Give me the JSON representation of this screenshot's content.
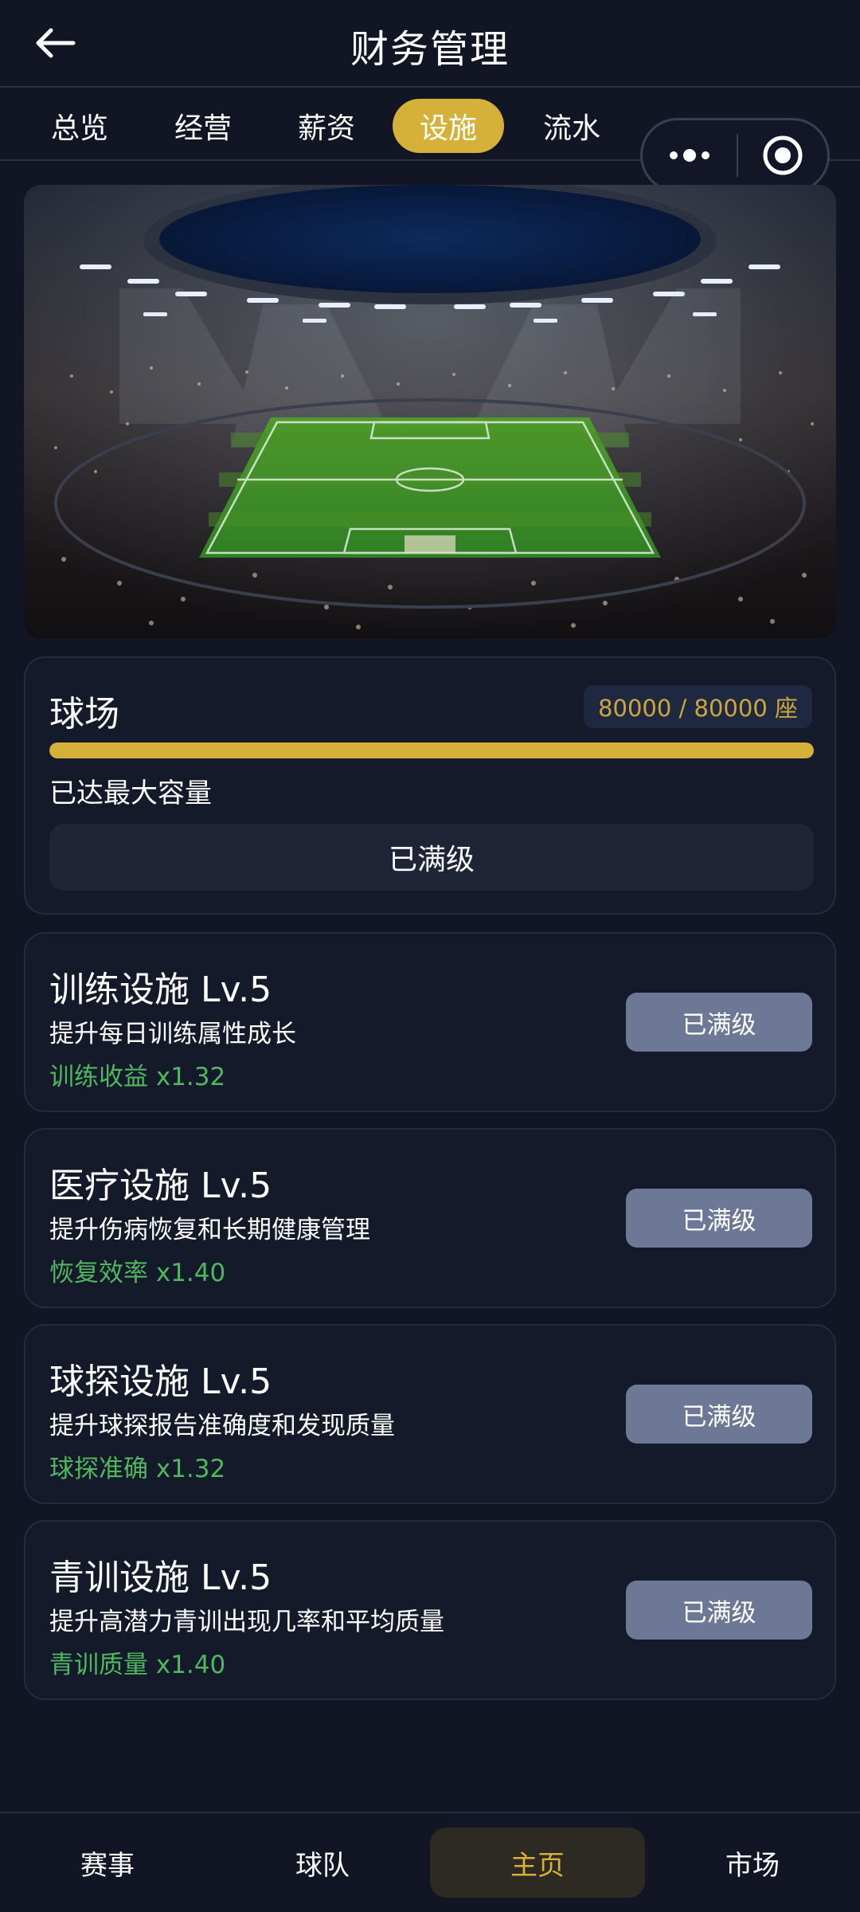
{
  "header": {
    "title": "财务管理",
    "back_icon": "arrow-left-icon"
  },
  "tabs": [
    {
      "label": "总览",
      "active": false
    },
    {
      "label": "经营",
      "active": false
    },
    {
      "label": "薪资",
      "active": false
    },
    {
      "label": "设施",
      "active": true
    },
    {
      "label": "流水",
      "active": false
    }
  ],
  "capsule": {
    "more_icon": "more-dots-icon",
    "close_icon": "target-circle-icon"
  },
  "stadium_image": {
    "icon": "football-stadium-image"
  },
  "stadium": {
    "title": "球场",
    "capacity": "80000 / 80000 座",
    "progress": 1.0,
    "status": "已达最大容量",
    "button": "已满级"
  },
  "facilities": [
    {
      "title": "训练设施 Lv.5",
      "desc": "提升每日训练属性成长",
      "bonus": "训练收益 x1.32",
      "button": "已满级"
    },
    {
      "title": "医疗设施 Lv.5",
      "desc": "提升伤病恢复和长期健康管理",
      "bonus": "恢复效率 x1.40",
      "button": "已满级"
    },
    {
      "title": "球探设施 Lv.5",
      "desc": "提升球探报告准确度和发现质量",
      "bonus": "球探准确 x1.32",
      "button": "已满级"
    },
    {
      "title": "青训设施 Lv.5",
      "desc": "提升高潜力青训出现几率和平均质量",
      "bonus": "青训质量 x1.40",
      "button": "已满级"
    }
  ],
  "bottom_nav": [
    {
      "label": "赛事",
      "active": false
    },
    {
      "label": "球队",
      "active": false
    },
    {
      "label": "主页",
      "active": true
    },
    {
      "label": "市场",
      "active": false
    }
  ],
  "colors": {
    "background": "#111524",
    "accent": "#d6b13a",
    "bonus_green": "#4fb85e",
    "button_gray": "#6c7895"
  }
}
